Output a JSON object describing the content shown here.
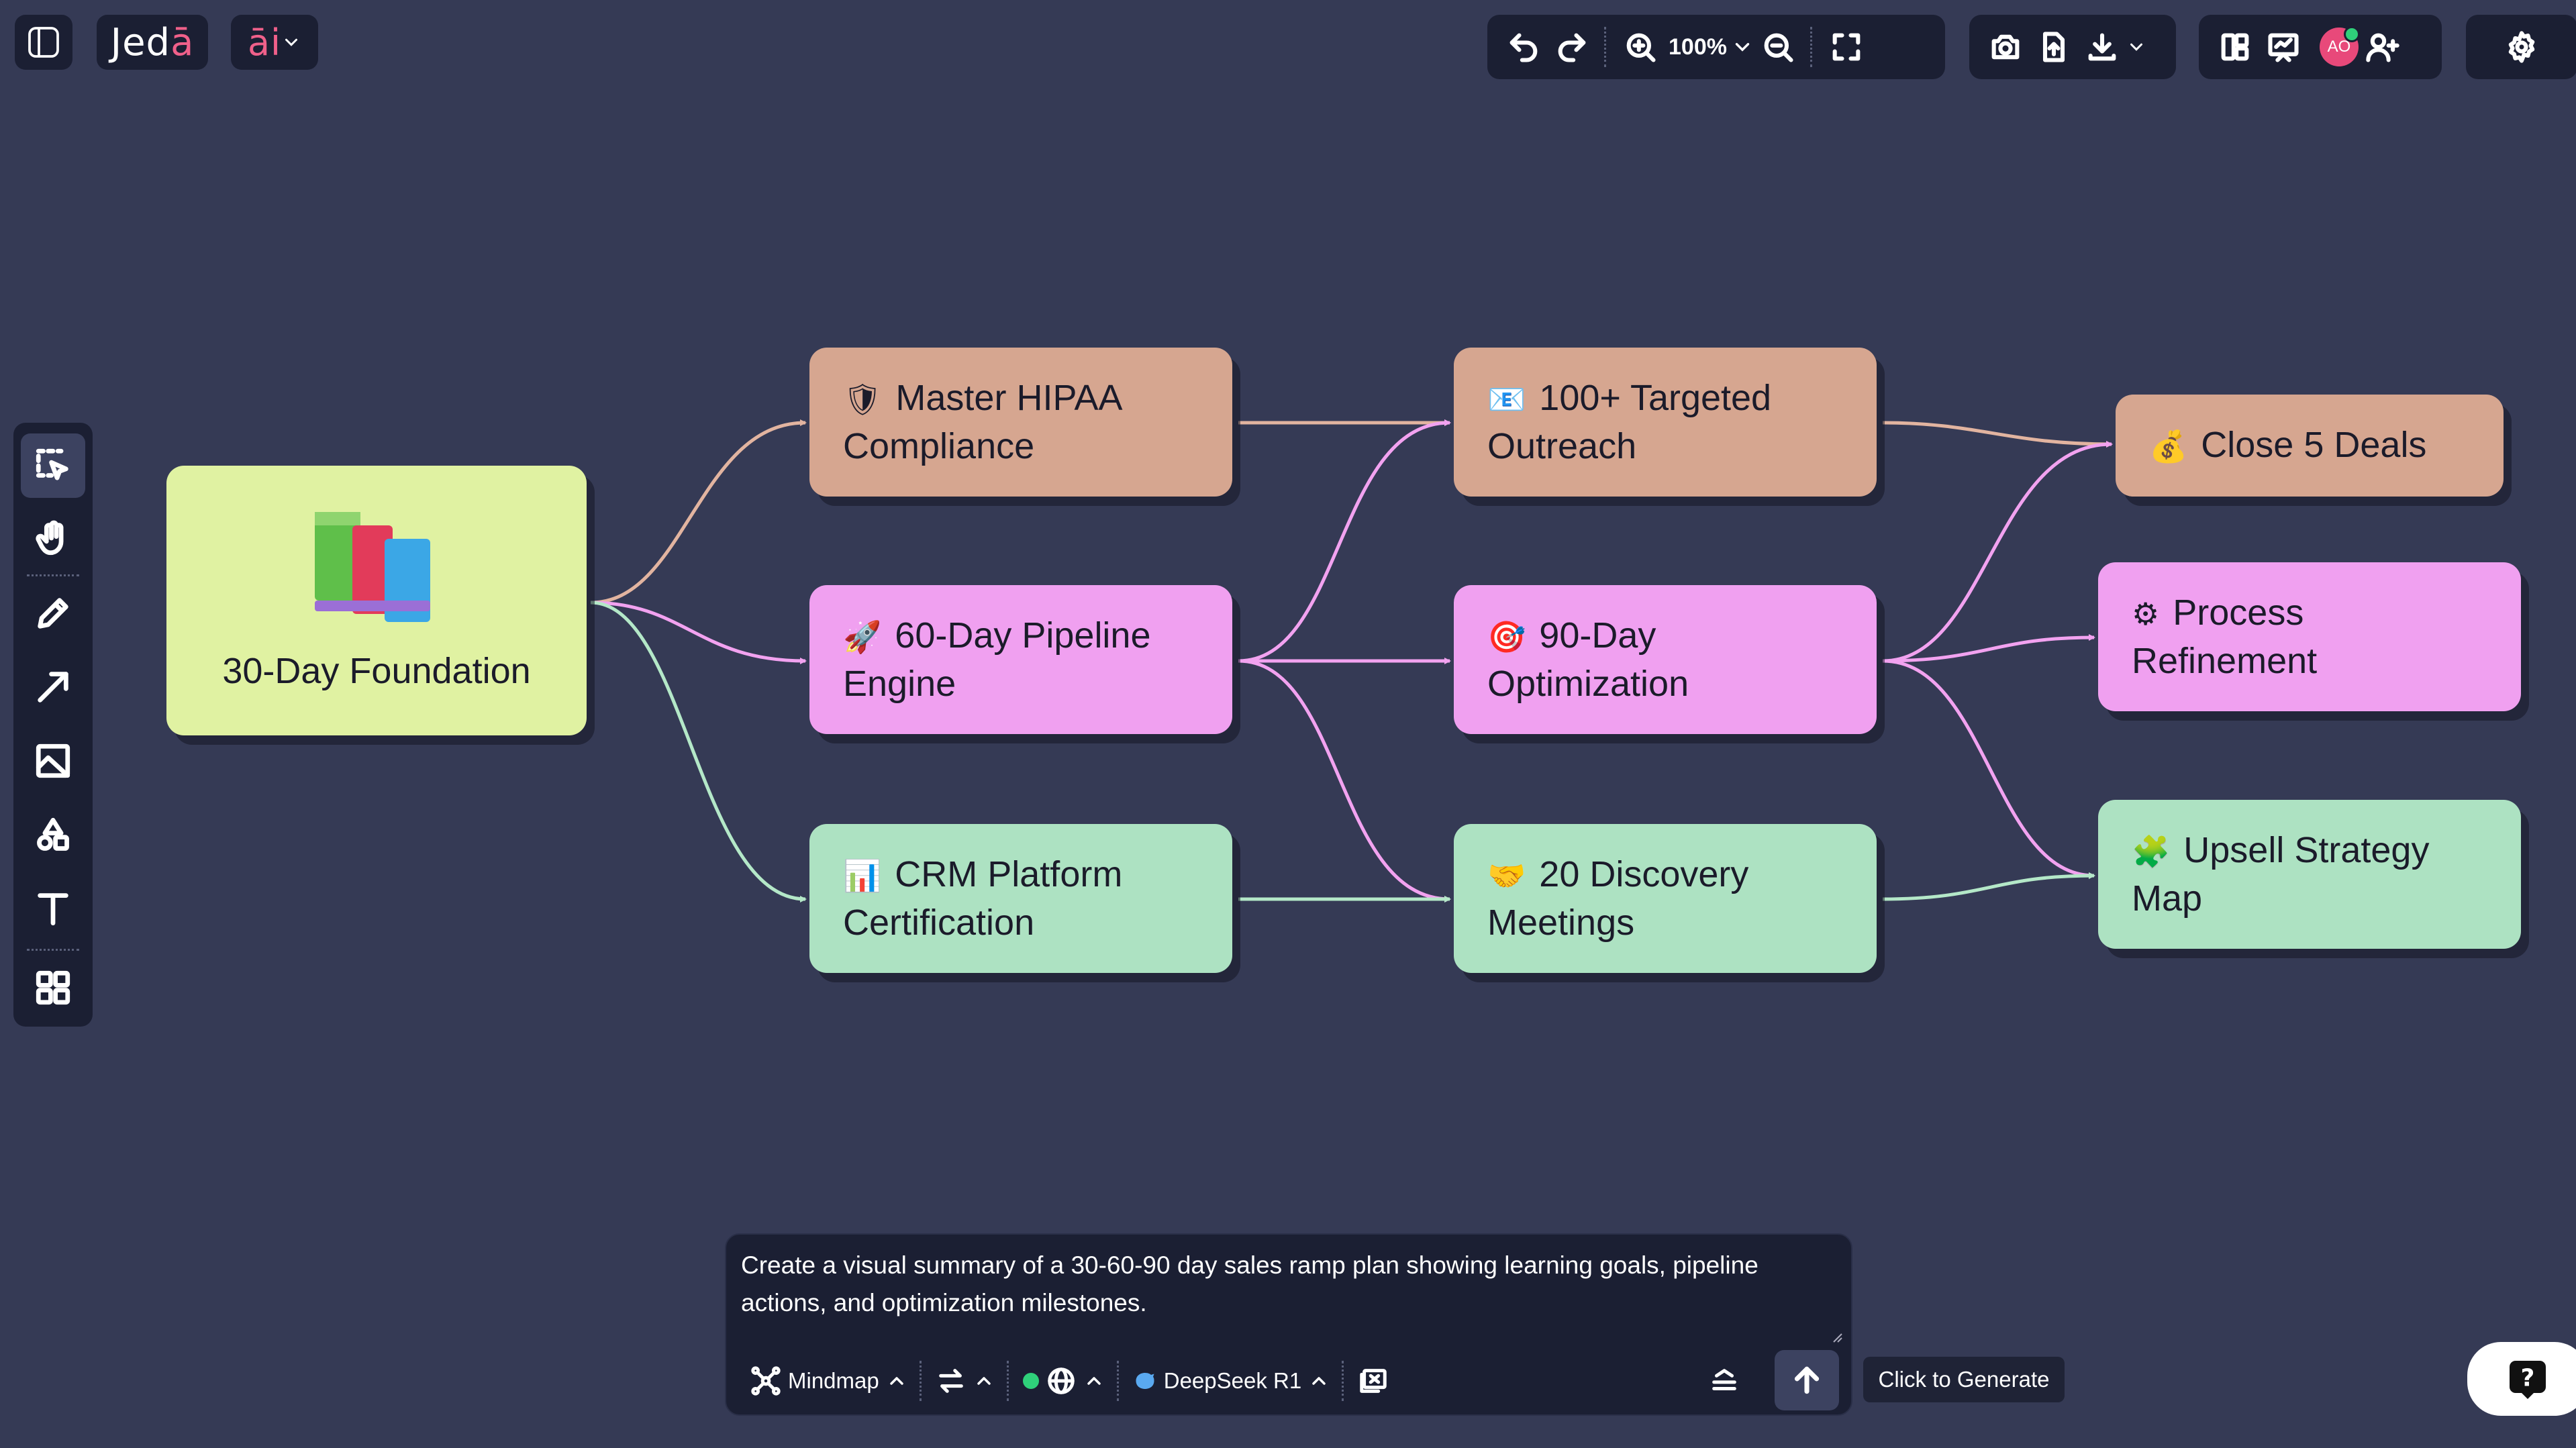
{
  "app": {
    "logo_text_main": "Jed",
    "logo_text_accent": "ā",
    "ai_label_main": "",
    "ai_label_accent": "āi"
  },
  "toolbar": {
    "zoom_value": "100%"
  },
  "user": {
    "initials": "AO"
  },
  "mindmap": {
    "root": {
      "label": "30-Day Foundation",
      "icon": "books-icon"
    },
    "nodes": [
      {
        "id": "hipaa",
        "emoji": "🛡",
        "label": "Master HIPAA Compliance"
      },
      {
        "id": "pipeline",
        "emoji": "🚀",
        "label": "60-Day Pipeline Engine"
      },
      {
        "id": "crm",
        "emoji": "📊",
        "label": "CRM Platform Certification"
      },
      {
        "id": "outreach",
        "emoji": "📧",
        "label": "100+ Targeted Outreach"
      },
      {
        "id": "optimize",
        "emoji": "🎯",
        "label": "90-Day Optimization"
      },
      {
        "id": "discovery",
        "emoji": "🤝",
        "label": "20 Discovery Meetings"
      },
      {
        "id": "close",
        "emoji": "💰",
        "label": "Close 5 Deals"
      },
      {
        "id": "process",
        "emoji": "⚙",
        "label": "Process Refinement"
      },
      {
        "id": "upsell",
        "emoji": "🧩",
        "label": "Upsell Strategy Map"
      }
    ],
    "colors": {
      "orange": "#d6a690",
      "pink": "#f0a0f0",
      "green": "#ade2c2",
      "root": "#e0f2a2"
    }
  },
  "prompt": {
    "text": "Create a visual summary of a 30-60-90 day sales ramp plan showing learning goals, pipeline actions, and optimization milestones.",
    "mode_label": "Mindmap",
    "model_label": "DeepSeek R1"
  },
  "tooltip": {
    "generate": "Click to Generate"
  },
  "help": {
    "label": "?"
  }
}
